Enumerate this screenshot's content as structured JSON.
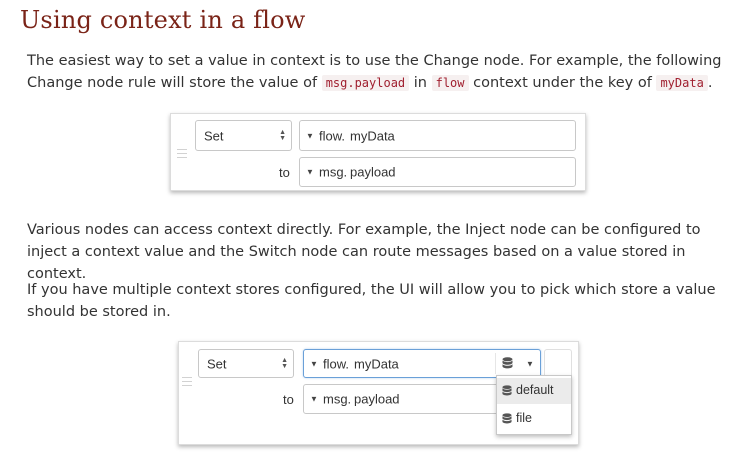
{
  "heading": "Using context in a flow",
  "para1": {
    "t1": "The easiest way to set a value in context is to use the Change node. For example, the following Change node rule will store the value of ",
    "code1": "msg.payload",
    "t2": " in ",
    "code2": "flow",
    "t3": " context under the key of ",
    "code3": "myData",
    "t4": "."
  },
  "para2": "Various nodes can access context directly. For example, the Inject node can be configured to inject a context value and the Switch node can route messages based on a value stored in context.",
  "para3": "If you have multiple context stores configured, the UI will allow you to pick which store a value should be stored in.",
  "example1": {
    "action": "Set",
    "target_type": "flow.",
    "target_value": "myData",
    "to_label": "to",
    "source_type": "msg.",
    "source_value": "payload"
  },
  "example2": {
    "action": "Set",
    "target_type": "flow.",
    "target_value": "myData",
    "to_label": "to",
    "source_type": "msg.",
    "source_value": "payload",
    "store_options": [
      "default",
      "file"
    ],
    "store_selected": "default",
    "store_icon": "database-icon"
  }
}
